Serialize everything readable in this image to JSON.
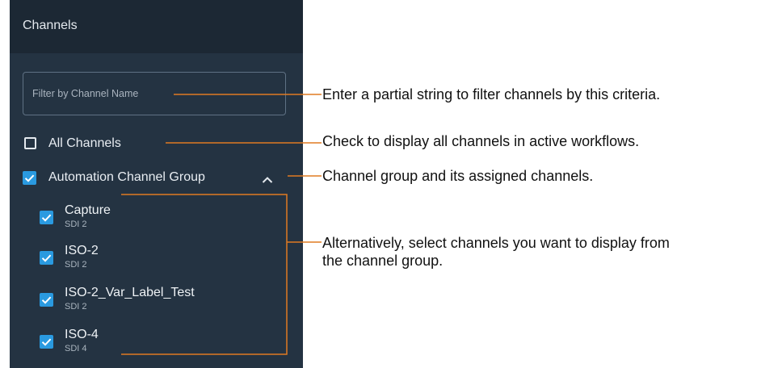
{
  "panel": {
    "title": "Channels",
    "filter": {
      "placeholder": "Filter by Channel Name",
      "value": ""
    },
    "all_channels": {
      "label": "All Channels",
      "checked": false
    },
    "group": {
      "label": "Automation Channel Group",
      "checked": true,
      "expanded": true,
      "chevron_icon": "chevron-up-icon"
    },
    "channels": [
      {
        "name": "Capture",
        "source": "SDI 2",
        "checked": true
      },
      {
        "name": "ISO-2",
        "source": "SDI 2",
        "checked": true
      },
      {
        "name": "ISO-2_Var_Label_Test",
        "source": "SDI 2",
        "checked": true
      },
      {
        "name": "ISO-4",
        "source": "SDI 4",
        "checked": true
      }
    ]
  },
  "annotations": {
    "filter": "Enter a partial string to filter channels by this criteria.",
    "all_channels": "Check to display all channels in active workflows.",
    "group": "Channel group and its assigned channels.",
    "channels_line1": "Alternatively, select channels you want to display from",
    "channels_line2": "the channel group."
  },
  "colors": {
    "panel_bg": "#243342",
    "header_bg": "#1c2834",
    "checkbox_accent": "#2a9ae0",
    "callout_line": "#e07b22"
  }
}
